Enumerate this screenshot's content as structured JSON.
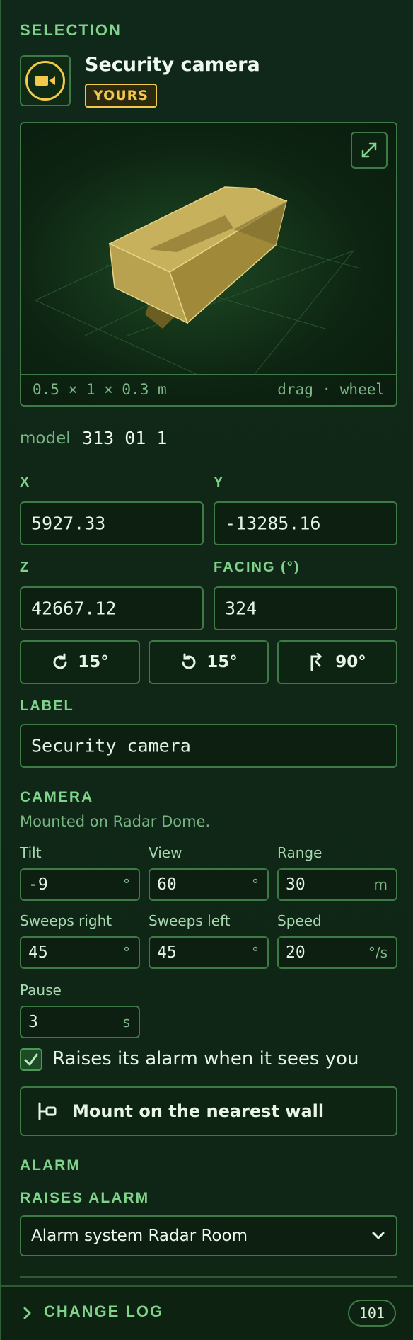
{
  "selection": {
    "section_label": "SELECTION",
    "title": "Security camera",
    "badge": "YOURS",
    "icon": "video-camera-icon"
  },
  "preview": {
    "dimensions": "0.5 × 1 × 0.3 m",
    "hint": "drag · wheel",
    "expand_icon": "expand-icon"
  },
  "model": {
    "label": "model",
    "value": "313_01_1"
  },
  "position": {
    "x_label": "X",
    "x_value": "5927.33",
    "y_label": "Y",
    "y_value": "-13285.16",
    "z_label": "Z",
    "z_value": "42667.12",
    "facing_label": "FACING (°)",
    "facing_value": "324"
  },
  "rotate_buttons": [
    {
      "label": "15°",
      "icon": "rotate-clockwise-icon"
    },
    {
      "label": "15°",
      "icon": "rotate-counterclockwise-icon"
    },
    {
      "label": "90°",
      "icon": "corner-arrow-icon"
    }
  ],
  "label_field": {
    "section_label": "LABEL",
    "value": "Security camera"
  },
  "camera": {
    "section_label": "CAMERA",
    "subtitle": "Mounted on Radar Dome.",
    "fields": [
      {
        "label": "Tilt",
        "value": "-9",
        "unit": "°"
      },
      {
        "label": "View",
        "value": "60",
        "unit": "°"
      },
      {
        "label": "Range",
        "value": "30",
        "unit": "m"
      },
      {
        "label": "Sweeps right",
        "value": "45",
        "unit": "°"
      },
      {
        "label": "Sweeps left",
        "value": "45",
        "unit": "°"
      },
      {
        "label": "Speed",
        "value": "20",
        "unit": "°/s"
      },
      {
        "label": "Pause",
        "value": "3",
        "unit": "s"
      }
    ],
    "alarm_checkbox_label": "Raises its alarm when it sees you",
    "alarm_checked": true,
    "mount_button": "Mount on the nearest wall"
  },
  "alarm": {
    "section_label": "ALARM",
    "raises_label": "RAISES ALARM",
    "selected": "Alarm system Radar Room"
  },
  "changelog": {
    "label": "CHANGE LOG",
    "count": "101"
  },
  "colors": {
    "accent": "#7fd38a",
    "gold": "#f2c94c",
    "border": "#3d7a45"
  }
}
